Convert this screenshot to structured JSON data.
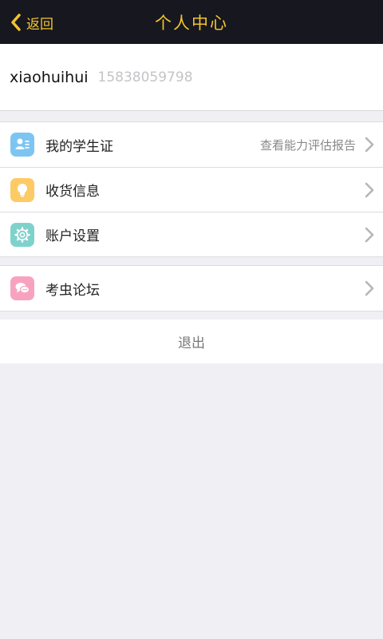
{
  "header": {
    "back_label": "返回",
    "title": "个人中心",
    "accent_color": "#f3c42b",
    "background_color": "#16171f"
  },
  "profile": {
    "username": "xiaohuihui",
    "phone": "15838059798"
  },
  "menu_group_1": [
    {
      "label": "我的学生证",
      "extra": "查看能力评估报告",
      "icon": "student-card-icon",
      "icon_color": "#7cc5f2"
    },
    {
      "label": "收货信息",
      "extra": "",
      "icon": "lightbulb-icon",
      "icon_color": "#fdca65"
    },
    {
      "label": "账户设置",
      "extra": "",
      "icon": "gear-icon",
      "icon_color": "#7fd2cb"
    }
  ],
  "menu_group_2": [
    {
      "label": "考虫论坛",
      "extra": "",
      "icon": "chat-bubbles-icon",
      "icon_color": "#f7a3c0"
    }
  ],
  "logout": {
    "label": "退出"
  }
}
